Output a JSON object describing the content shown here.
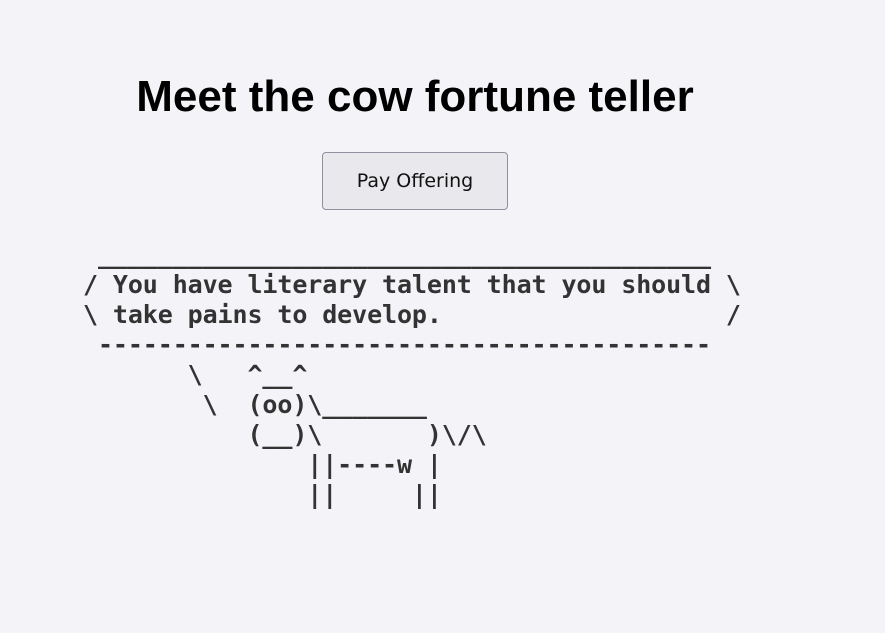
{
  "page": {
    "title": "Meet the cow fortune teller"
  },
  "actions": {
    "pay_offering_label": "Pay Offering"
  },
  "fortune": {
    "message": "You have literary talent that you should take pains to develop.",
    "cowsay_output": " _________________________________________\n/ You have literary talent that you should \\\n\\ take pains to develop.                   /\n -----------------------------------------\n       \\   ^__^\n        \\  (oo)\\_______\n           (__)\\       )\\/\\\n               ||----w |\n               ||     ||"
  }
}
